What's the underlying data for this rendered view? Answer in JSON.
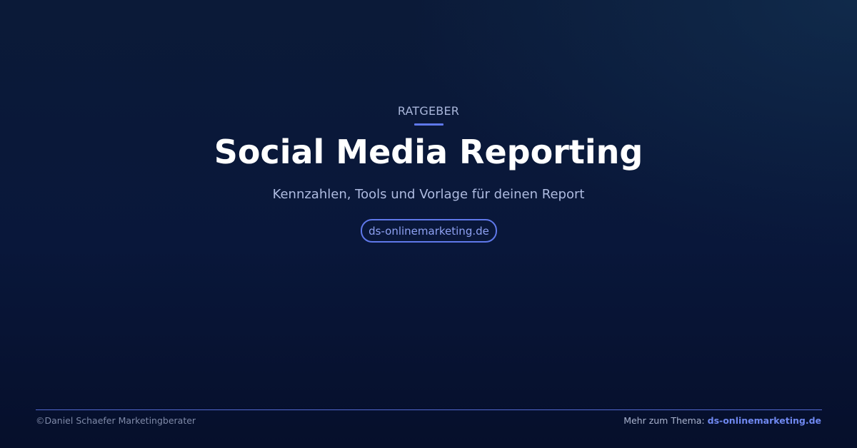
{
  "header": {
    "eyebrow": "RATGEBER"
  },
  "main": {
    "title": "Social Media Reporting",
    "subtitle": "Kennzahlen, Tools und Vorlage für deinen Report",
    "pill_link": "ds-onlinemarketing.de"
  },
  "footer": {
    "copyright": "©Daniel Schaefer Marketingberater",
    "more_label": "Mehr zum Thema:",
    "more_link": "ds-onlinemarketing.de"
  },
  "colors": {
    "accent": "#5f78ea",
    "background": "#0b1a38",
    "title": "#ffffff",
    "subtitle": "#aebbe0"
  }
}
